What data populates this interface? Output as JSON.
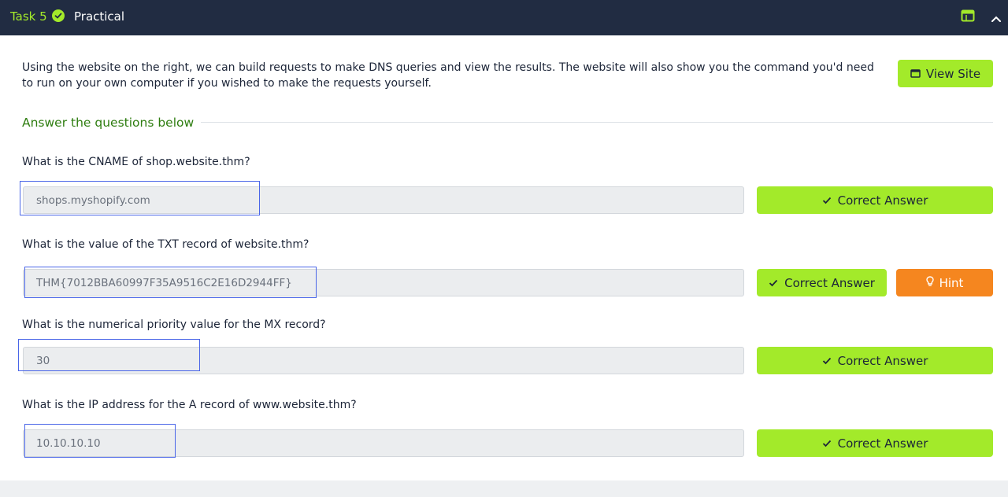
{
  "header": {
    "task_label": "Task 5",
    "title": "Practical",
    "icons": [
      "check-circle-icon",
      "panel-icon",
      "chevron-up-icon"
    ]
  },
  "intro": {
    "text": "Using the website on the right, we can build requests to make DNS queries and view the results. The website will also show you the command you'd need to run on your own computer if you wished to make the requests yourself.",
    "view_site_label": "View Site"
  },
  "answers_heading": "Answer the questions below",
  "questions": [
    {
      "question": "What is the CNAME of shop.website.thm?",
      "answer": "shops.myshopify.com",
      "status": "Correct Answer"
    },
    {
      "question": "What is the value of the TXT record of website.thm?",
      "answer": "THM{7012BBA60997F35A9516C2E16D2944FF}",
      "status": "Correct Answer",
      "hint_label": "Hint"
    },
    {
      "question": "What is the numerical priority value for the MX record?",
      "answer": "30",
      "status": "Correct Answer"
    },
    {
      "question": "What is the IP address for the A record of www.website.thm?",
      "answer": "10.10.10.10",
      "status": "Correct Answer"
    }
  ],
  "colors": {
    "header_bg": "#212c42",
    "accent_green": "#a3ea2a",
    "heading_green": "#2e7d10",
    "hint_orange": "#f5861f",
    "highlight_blue": "#4a66e8"
  }
}
